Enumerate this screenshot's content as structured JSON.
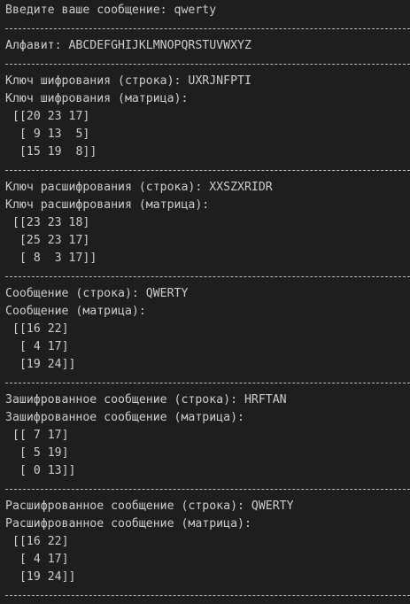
{
  "terminal": {
    "lines": [
      {
        "text": "Введите ваше сообщение: qwerty"
      },
      {
        "sep": true
      },
      {
        "text": "Алфавит: ABCDEFGHIJKLMNOPQRSTUVWXYZ"
      },
      {
        "sep": true
      },
      {
        "text": "Ключ шифрования (строка): UXRJNFPTI"
      },
      {
        "text": "Ключ шифрования (матрица):"
      },
      {
        "text": "[[20 23 17]",
        "matrix": true
      },
      {
        "text": " [ 9 13  5]",
        "matrix": true
      },
      {
        "text": " [15 19  8]]",
        "matrix": true
      },
      {
        "sep": true
      },
      {
        "text": "Ключ расшифрования (строка): XXSZXRIDR"
      },
      {
        "text": "Ключ расшифрования (матрица):"
      },
      {
        "text": "[[23 23 18]",
        "matrix": true
      },
      {
        "text": " [25 23 17]",
        "matrix": true
      },
      {
        "text": " [ 8  3 17]]",
        "matrix": true
      },
      {
        "sep": true
      },
      {
        "text": "Сообщение (строка): QWERTY"
      },
      {
        "text": "Сообщение (матрица):"
      },
      {
        "text": "[[16 22]",
        "matrix": true
      },
      {
        "text": " [ 4 17]",
        "matrix": true
      },
      {
        "text": " [19 24]]",
        "matrix": true
      },
      {
        "sep": true
      },
      {
        "text": "Зашифрованное сообщение (строка): HRFTAN"
      },
      {
        "text": "Зашифрованное сообщение (матрица):"
      },
      {
        "text": "[[ 7 17]",
        "matrix": true
      },
      {
        "text": " [ 5 19]",
        "matrix": true
      },
      {
        "text": " [ 0 13]]",
        "matrix": true
      },
      {
        "sep": true
      },
      {
        "text": "Расшифрованное сообщение (строка): QWERTY"
      },
      {
        "text": "Расшифрованное сообщение (матрица):"
      },
      {
        "text": "[[16 22]",
        "matrix": true
      },
      {
        "text": " [ 4 17]",
        "matrix": true
      },
      {
        "text": " [19 24]]",
        "matrix": true
      },
      {
        "sep": true
      }
    ]
  },
  "colors": {
    "background": "#1e1e1e",
    "text": "#cccccc",
    "separator": "#bbbbbb"
  }
}
